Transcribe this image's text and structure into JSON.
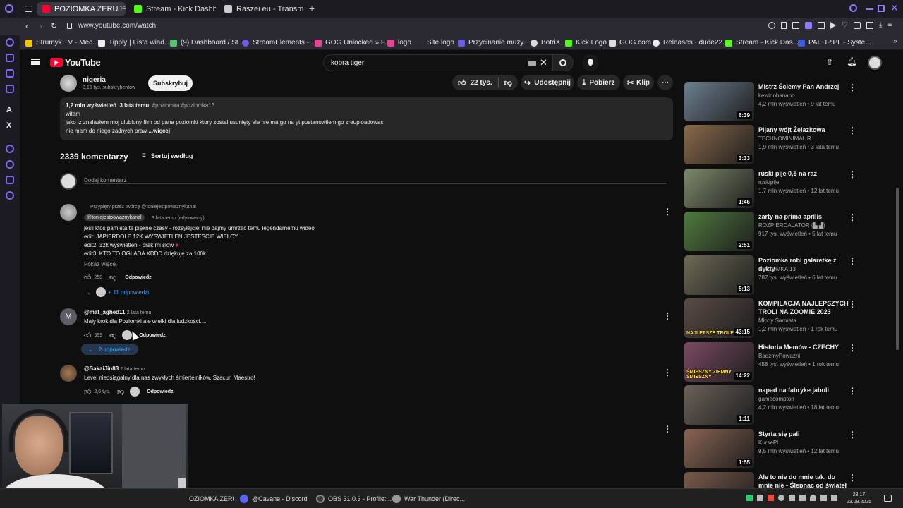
{
  "browser": {
    "tabs": [
      {
        "label": "POZIOMKA ZERUJE Ł",
        "active": true,
        "color": "#ff0033"
      },
      {
        "label": "Stream - Kick Dashboard",
        "active": false,
        "color": "#53fc18"
      },
      {
        "label": "Raszei.eu - Transmisje, N",
        "active": false,
        "color": "#cccccc"
      }
    ],
    "url": "www.youtube.com/watch",
    "bookmarks": [
      "Strumyk.TV - Mec...",
      "Tipply | Lista wiad...",
      "(9) Dashboard / St...",
      "StreamElements -...",
      "GOG Unlocked » F...",
      "logo",
      "Site logo",
      "Przycinanie muzy...",
      "BotriX",
      "Kick Logo",
      "GOG.com",
      "Releases · dude22...",
      "Stream - Kick Das...",
      "PALTIP.PL - Syste..."
    ]
  },
  "youtube": {
    "logo_text": "YouTube",
    "search_value": "kobra tiger",
    "channel": {
      "name": "nigeria",
      "subs": "3,15 tys. subskrybentów",
      "subscribe_label": "Subskrybuj"
    },
    "actions": {
      "likes": "22 tys.",
      "share": "Udostępnij",
      "download": "Pobierz",
      "clip": "Klip"
    },
    "description": {
      "views": "1,2 mln wyświetleń",
      "age": "3 lata temu",
      "tags": "#poziomka #poziomka13",
      "line1": "witam",
      "line2": "jako iż znalazłem moj ulubiony film od pana poziomki ktory zostal usunięty ale nie ma go na yt postanowilem go zreuploadowac",
      "line3": "nie mam do niego zadnych praw",
      "more": "...więcej"
    },
    "comments_header": {
      "count": "2339 komentarzy",
      "sort": "Sortuj według"
    },
    "add_comment": "Dodaj komentarz",
    "comments": [
      {
        "pinned": "Przypięty przez twórcę @toniejestpowaznykanal",
        "author": "@toniejestpowaznykanal",
        "time": "3 lata temu (edytowany)",
        "lines": [
          "jeśli ktoś pamięta te piękne czasy - rozsyłajcie! nie dajmy umrzeć temu legendarnemu wideo",
          "edit: JAPIERDOLE 12K WYSWIETLEN JESTESCIE WIELCY",
          "edit2: 32k wyswietlen - brak mi slow",
          "edit3: KTO TO OGLADA XDDD dziękuję za 100k.."
        ],
        "show_more": "Pokaż więcej",
        "likes": "250",
        "reply": "Odpowiedz",
        "replies": "11 odpowiedzi"
      },
      {
        "author": "@mat_aghed11",
        "time": "2 lata temu",
        "lines": [
          "Mały krok dla Poziomki ale wielki dla ludzkości...."
        ],
        "likes": "599",
        "reply": "Odpowiedz",
        "replies": "2 odpowiedzi",
        "avatar_letter": "M"
      },
      {
        "author": "@SakaiJin83",
        "time": "2 lata temu",
        "lines": [
          "Level nieosiągalny dla nas zwykłych śmiertelników. Szacun Maestro!"
        ],
        "likes": "2,6 tys.",
        "reply": "Odpowiedz"
      }
    ],
    "related": [
      {
        "title": "Mistrz Ściemy Pan Andrzej",
        "channel": "kewinobanano",
        "meta": "4,2 mln wyświetleń • 9 lat temu",
        "duration": "6:39",
        "color": "#6d7f8f"
      },
      {
        "title": "Pijany wójt Żelazkowa",
        "channel": "TECHNOMINIMAL R",
        "meta": "1,9 mln wyświetleń • 3 lata temu",
        "duration": "3:33",
        "color": "#8a6a4a"
      },
      {
        "title": "ruski pije 0,5 na raz",
        "channel": "ruskipije",
        "meta": "1,7 mln wyświetleń • 12 lat temu",
        "duration": "1:46",
        "color": "#7d8a6b"
      },
      {
        "title": "żarty na prima aprilis",
        "channel": "ROZPIERDALATOR (▙ ▟)",
        "meta": "917 tys. wyświetleń • 5 lat temu",
        "duration": "2:51",
        "color": "#4f7a3e"
      },
      {
        "title": "Poziomka robi galaretkę z dykty",
        "channel": "POZIOMKA 13",
        "meta": "787 tys. wyświetleń • 6 lat temu",
        "duration": "5:13",
        "color": "#6e6a55"
      },
      {
        "title": "KOMPILACJA NAJLEPSZYCH TROLI NA ZOOMIE 2023",
        "channel": "Młody Sarmata",
        "meta": "1,2 mln wyświetleń • 1 rok temu",
        "duration": "43:15",
        "color": "#5a4b45",
        "overlay": "NAJLEPSZE TROLE"
      },
      {
        "title": "Historia Memów - CZECHY",
        "channel": "BadzmyPowazni",
        "meta": "458 tys. wyświetleń • 1 rok temu",
        "duration": "14:22",
        "color": "#7a4a62",
        "overlay": "ŚMIESZNY ZIEMNY ŚMIESZNY"
      },
      {
        "title": "napad na fabryke jaboli",
        "channel": "gamecompton",
        "meta": "4,2 mln wyświetleń • 18 lat temu",
        "duration": "1:11",
        "color": "#6b6158"
      },
      {
        "title": "Styrta się pali",
        "channel": "KursePl",
        "meta": "9,5 mln wyświetleń • 12 lat temu",
        "duration": "1:55",
        "color": "#8a6452"
      },
      {
        "title": "Ale to nie do mnie tak, do mnie nie - Ślepnąc od świateł",
        "channel": "",
        "meta": "",
        "duration": "",
        "color": "#7a5a4a"
      }
    ]
  },
  "taskbar": {
    "items": [
      {
        "label": "OZIOMKA ZERUJE...",
        "color": "#ff6a00"
      },
      {
        "label": "@Cavane - Discord",
        "color": "#5865f2"
      },
      {
        "label": "OBS 31.0.3 - Profile:...",
        "color": "#444"
      },
      {
        "label": "War Thunder (Direc...",
        "color": "#999"
      }
    ],
    "time": "23:17",
    "date": "23.09.2025"
  }
}
